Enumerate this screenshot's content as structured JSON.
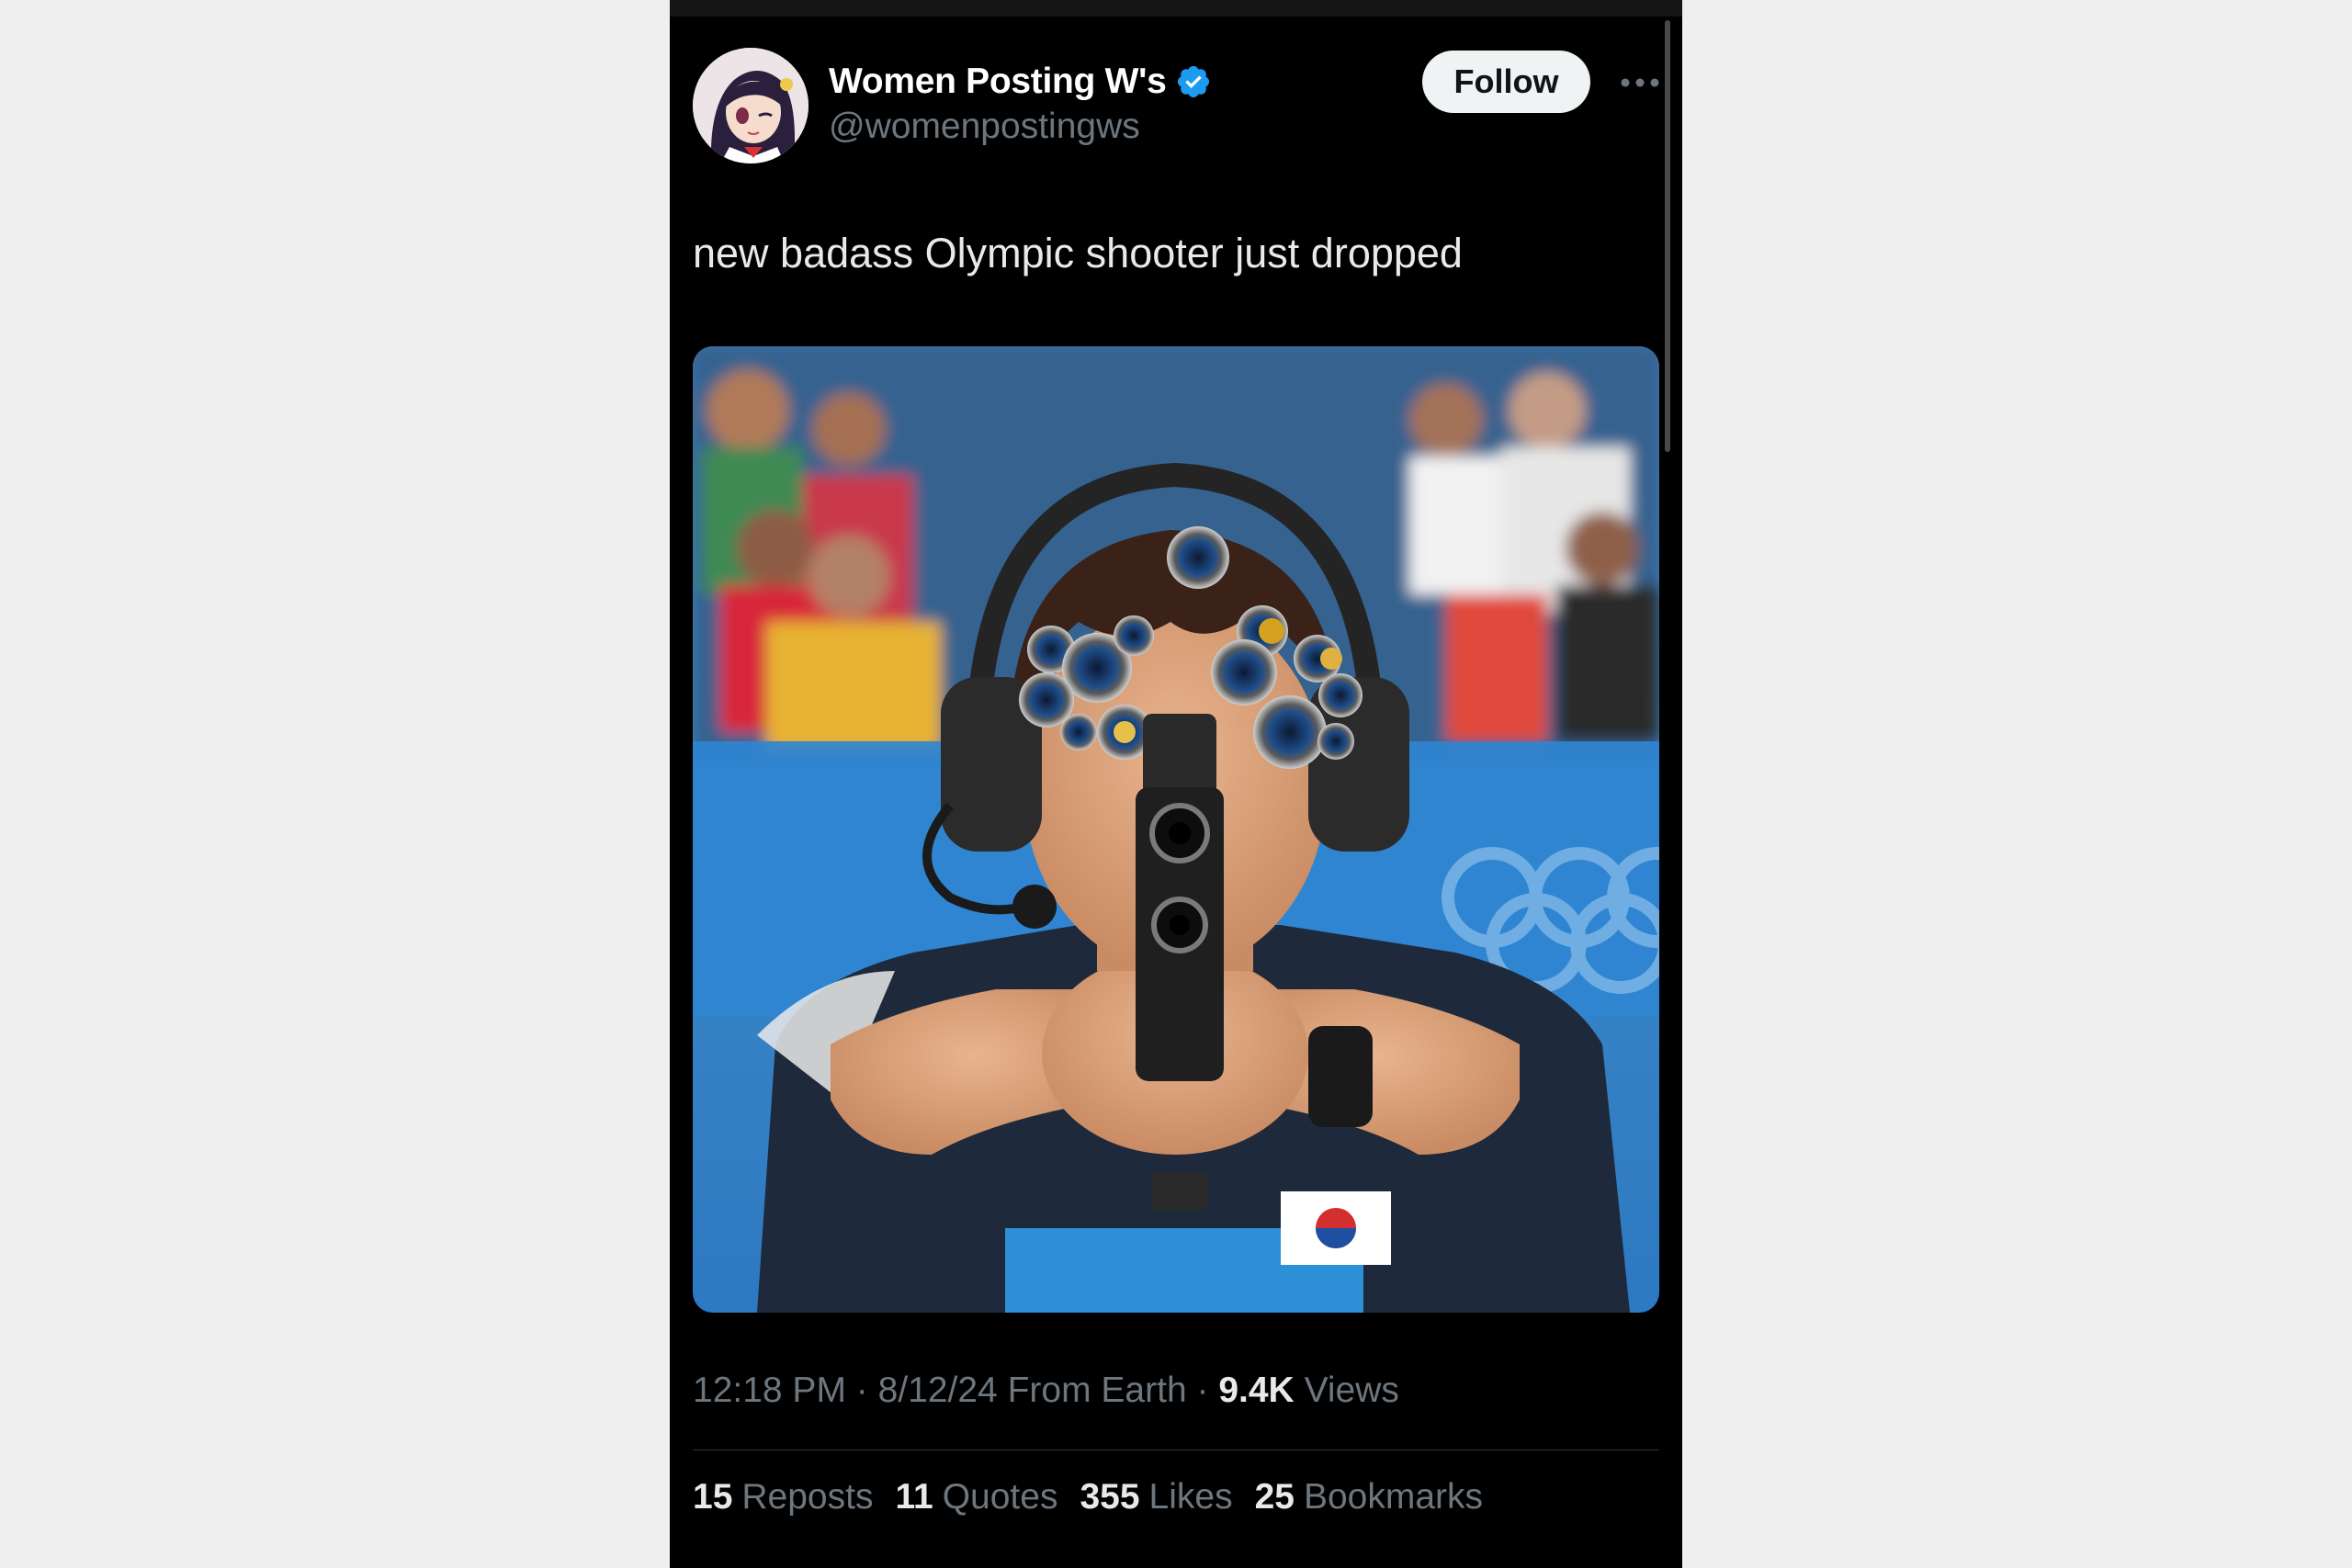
{
  "tweet": {
    "display_name": "Women Posting W's",
    "handle": "@womenpostingws",
    "follow_label": "Follow",
    "text": "new badass Olympic shooter just dropped",
    "time": "12:18 PM",
    "separator": "·",
    "date": "8/12/24",
    "source": "From Earth",
    "views_count": "9.4K",
    "views_label": "Views"
  },
  "stats": [
    {
      "count": "15",
      "label": "Reposts"
    },
    {
      "count": "11",
      "label": "Quotes"
    },
    {
      "count": "355",
      "label": "Likes"
    },
    {
      "count": "25",
      "label": "Bookmarks"
    }
  ],
  "icons": {
    "verified": "verified-badge-icon",
    "more": "more-options-icon"
  },
  "colors": {
    "background": "#000000",
    "page_bg": "#efefef",
    "primary_text": "#e7e9ea",
    "secondary_text": "#6e767d",
    "verified_blue": "#1d9bf0",
    "follow_bg": "#eff3f4"
  }
}
